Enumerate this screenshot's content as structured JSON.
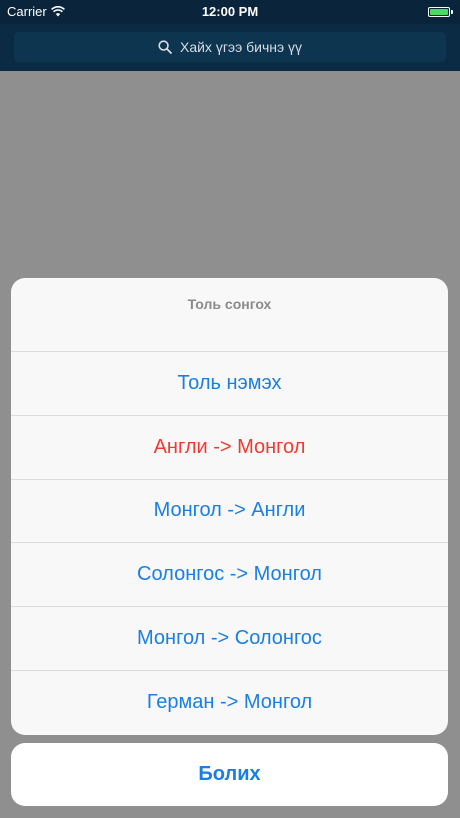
{
  "status_bar": {
    "carrier": "Carrier",
    "time": "12:00 PM"
  },
  "search": {
    "placeholder": "Хайх үгээ бичнэ үү"
  },
  "action_sheet": {
    "title": "Толь сонгох",
    "items": [
      {
        "label": "Толь нэмэх",
        "style": "default"
      },
      {
        "label": "Англи -> Монгол",
        "style": "destructive"
      },
      {
        "label": "Монгол -> Англи",
        "style": "default"
      },
      {
        "label": "Солонгос -> Монгол",
        "style": "default"
      },
      {
        "label": "Монгол -> Солонгос",
        "style": "default"
      },
      {
        "label": "Герман -> Монгол",
        "style": "default"
      }
    ],
    "cancel_label": "Болих"
  },
  "colors": {
    "accent": "#1a7fe0",
    "destructive": "#f03a2f",
    "nav_background": "#0b2a44",
    "dim_background": "#8f8f8f",
    "battery": "#4cd964"
  }
}
